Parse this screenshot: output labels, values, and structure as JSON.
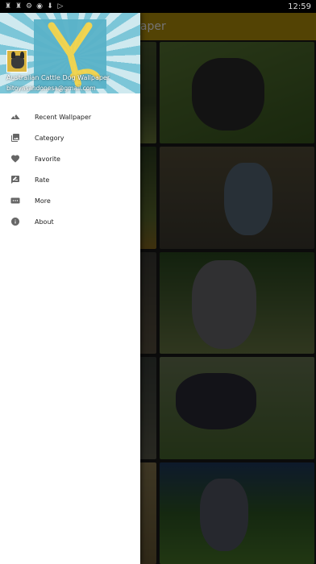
{
  "status_bar": {
    "time": "12:59",
    "icons": [
      "notification-icon",
      "notification-icon",
      "settings-icon",
      "android-icon",
      "download-icon",
      "play-icon"
    ]
  },
  "app": {
    "toolbar_title_fragment": "paper",
    "toolbar_color": "#b9950b"
  },
  "drawer": {
    "header": {
      "title": "Australian Cattle Dog Wallpaper",
      "email": "bitoyasandonesa@gmail.com"
    },
    "items": [
      {
        "label": "Recent Wallpaper",
        "icon": "landscape-icon"
      },
      {
        "label": "Category",
        "icon": "collections-icon"
      },
      {
        "label": "Favorite",
        "icon": "heart-icon"
      },
      {
        "label": "Rate",
        "icon": "rate-review-icon"
      },
      {
        "label": "More",
        "icon": "more-icon"
      },
      {
        "label": "About",
        "icon": "info-icon"
      }
    ]
  },
  "gallery": {
    "tile_count": 10
  }
}
